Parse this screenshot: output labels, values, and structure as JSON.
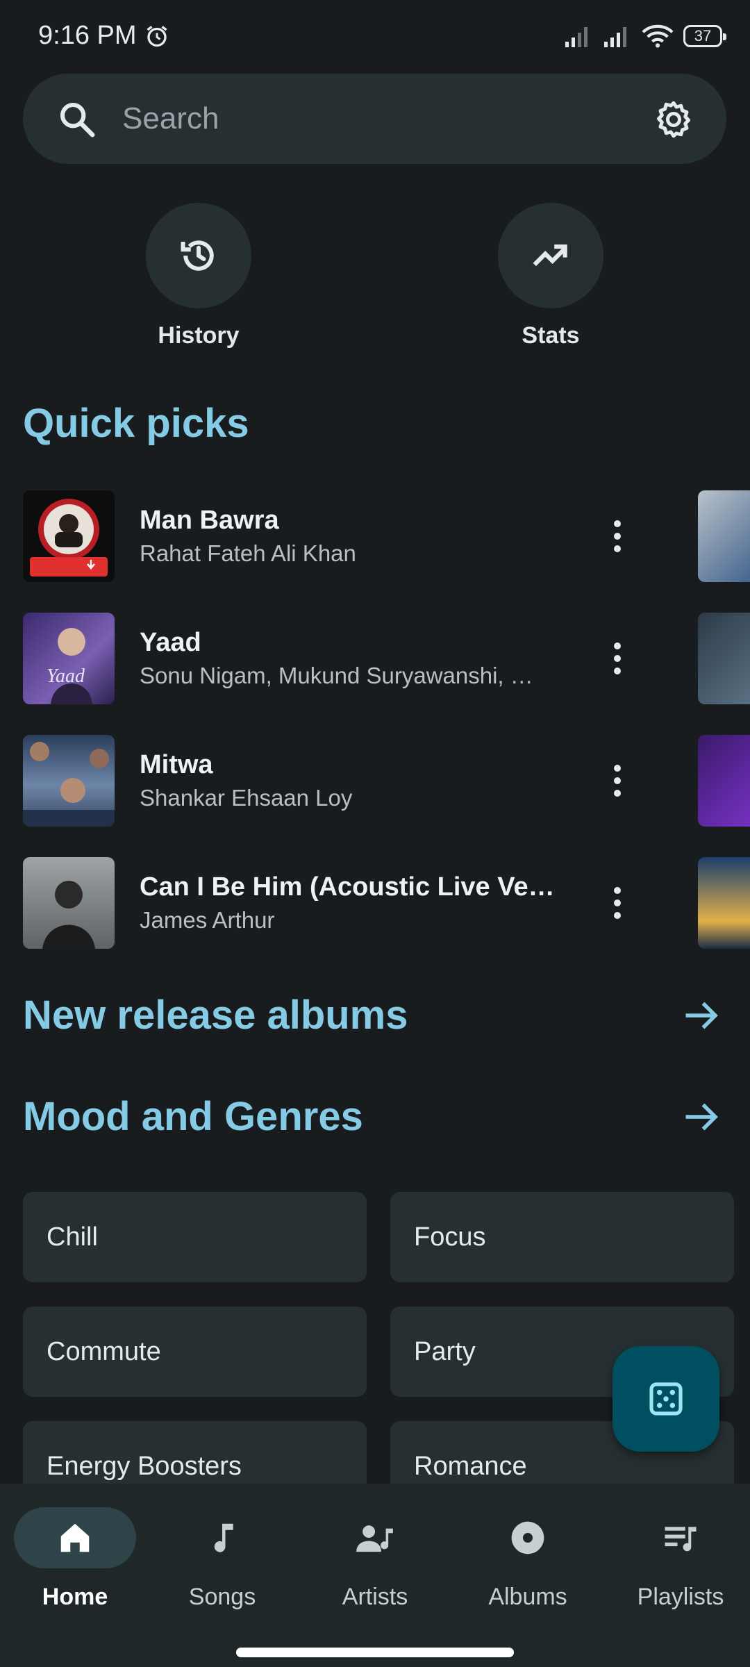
{
  "status_bar": {
    "time": "9:16 PM",
    "battery": "37"
  },
  "search": {
    "placeholder": "Search"
  },
  "quick_actions": [
    {
      "label": "History",
      "icon": "history-icon"
    },
    {
      "label": "Stats",
      "icon": "trending-up-icon"
    }
  ],
  "quick_picks": {
    "title": "Quick picks",
    "songs": [
      {
        "title": "Man Bawra",
        "artist": "Rahat Fateh Ali Khan",
        "thumb_color": "#b81f25"
      },
      {
        "title": "Yaad",
        "artist": "Sonu Nigam, Mukund Suryawanshi, …",
        "thumb_color": "#5b3f8f"
      },
      {
        "title": "Mitwa",
        "artist": "Shankar Ehsaan Loy",
        "thumb_color": "#41597d"
      },
      {
        "title": "Can I Be Him (Acoustic Live Ve…",
        "artist": "James Arthur",
        "thumb_color": "#6a6f72"
      }
    ]
  },
  "new_release": {
    "title": "New release albums"
  },
  "moods": {
    "title": "Mood and Genres",
    "items": [
      "Chill",
      "Focus",
      "Commute",
      "Party",
      "Energy Boosters",
      "Romance"
    ]
  },
  "nav": [
    {
      "label": "Home",
      "icon": "home-icon",
      "active": true
    },
    {
      "label": "Songs",
      "icon": "music-note-icon"
    },
    {
      "label": "Artists",
      "icon": "artist-icon"
    },
    {
      "label": "Albums",
      "icon": "album-icon"
    },
    {
      "label": "Playlists",
      "icon": "playlist-icon"
    }
  ],
  "colors": {
    "accent": "#86cbe6",
    "background": "#181c1e",
    "surface": "#263033",
    "fab": "#004f60"
  }
}
